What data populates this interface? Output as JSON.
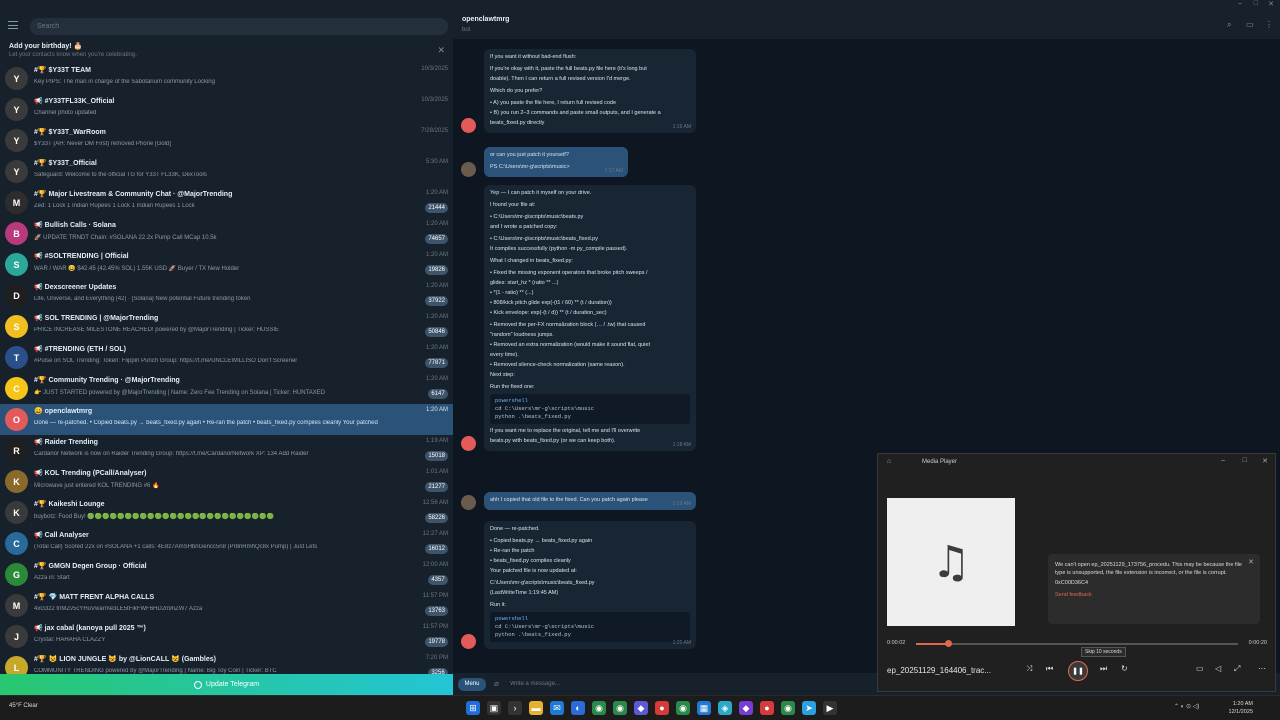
{
  "window": {
    "minimize": "–",
    "maximize": "□",
    "close": "✕"
  },
  "sidebar": {
    "search_placeholder": "Search",
    "birthday": {
      "title": "Add your birthday! 🎂",
      "subtitle": "Let your contacts know when you're celebrating."
    },
    "chats": [
      {
        "name": "#🏆 $Y33T TEAM",
        "time": "10/3/2025",
        "preview": "Key PIPS: The man in charge of the Sabotarium community Locking",
        "badge": "",
        "color": "#3a3a3a",
        "initial": "Y"
      },
      {
        "name": "📢 #Y33TFL33K_Official",
        "time": "10/3/2025",
        "preview": "Channel photo updated",
        "badge": "",
        "color": "#3a3a3a",
        "initial": "Y"
      },
      {
        "name": "#🏆 $Y33T_WarRoom",
        "time": "7/28/2025",
        "preview": "$Y33T (AH: Never DM First) removed Phone [Gold]",
        "badge": "",
        "color": "#3a3a3a",
        "initial": "Y"
      },
      {
        "name": "#🏆 $Y33T_Official",
        "time": "5:30 AM",
        "preview": "Safeguard: Welcome to the official TG for Y33T FL33K, DexTools",
        "badge": "",
        "color": "#3a3a3a",
        "initial": "Y"
      },
      {
        "name": "#🏆 Major Livestream & Community Chat · @MajorTrending",
        "time": "1:20 AM",
        "preview": "Zed: 1 Lock 1 Indian Rupees 1 Lock 1 Indian Rupees 1 Lock",
        "badge": "21444",
        "color": "#2d2d2d",
        "initial": "M"
      },
      {
        "name": "📢 Bullish Calls · Solana",
        "time": "1:20 AM",
        "preview": "🚀 UPDATE TRNDT Chain: #SOLANA 22.2x Pump Call MCap 10.5k",
        "badge": "74657",
        "color": "#b83a7a",
        "initial": "B"
      },
      {
        "name": "📢 #SOLTRENDING | Official",
        "time": "1:20 AM",
        "preview": "WAR / WAR 😀 $42.45 (42.45% SOL) 1.55K USD 🚀 Buyer / TX New Holder",
        "badge": "19826",
        "color": "#2aa89a",
        "initial": "S"
      },
      {
        "name": "📢 Dexscreener Updates",
        "time": "1:20 AM",
        "preview": "Life, Universe, and Everything (42) · [Solana] New potential Future trending token",
        "badge": "37922",
        "color": "#1f1f1f",
        "initial": "D"
      },
      {
        "name": "📢 SOL TRENDING | @MajorTrending",
        "time": "1:20 AM",
        "preview": "PRICE INCREASE MILESTONE REACHED! powered by @MajorTrending | Ticker: HUSSIE",
        "badge": "50846",
        "color": "#f0c020",
        "initial": "S"
      },
      {
        "name": "📢 #TRENDING (ETH / SOL)",
        "time": "1:20 AM",
        "preview": "#Pulse on SOL Trending: Token: Flippin Punch Group: https://t.me/UNCLEWILLISO Don't Screener",
        "badge": "77871",
        "color": "#2a4f8a",
        "initial": "T"
      },
      {
        "name": "#🏆 Community Trending · @MajorTrending",
        "time": "1:20 AM",
        "preview": "👉 JUST STARTED powered by @MajorTrending | Name: Zero Fee Trending on Solana | Ticker: HUNTAXED",
        "badge": "6147",
        "color": "#f5c518",
        "initial": "C"
      },
      {
        "name": "😀 openclawtmrg",
        "time": "1:20 AM",
        "preview": "Done — re-patched. • Copied beats.py → beats_fixed.py again • Re-ran the patch • beats_fixed.py compiles cleanly Your patched",
        "badge": "",
        "color": "#e35a5a",
        "initial": "O"
      },
      {
        "name": "📢 Raider Trending",
        "time": "1:19 AM",
        "preview": "Cardanor Network is now on Raider Trending Group: https://t.me/CardanorNetwork XP: 134 Add Raider",
        "badge": "15018",
        "color": "#1f1f1f",
        "initial": "R"
      },
      {
        "name": "📢 KOL Trending (PCall/Analyser)",
        "time": "1:01 AM",
        "preview": "Microwave just entered KOL TRENDING #6 🔥",
        "badge": "21277",
        "color": "#8a6a2a",
        "initial": "K"
      },
      {
        "name": "#🏆 Kaikeshi Lounge",
        "time": "12:56 AM",
        "preview": "buybotz: Food Buy! 🟢🟢🟢🟢🟢🟢🟢🟢🟢🟢🟢🟢🟢🟢🟢🟢🟢🟢🟢🟢🟢🟢🟢🟢🟢",
        "badge": "58226",
        "color": "#3a3a3a",
        "initial": "K"
      },
      {
        "name": "📢 Call Analyser",
        "time": "12:27 AM",
        "preview": "(Total Call) Scored 22x on #SOLANA +1 calls: 4E8z7AmSHbnGencc5n8 (Pr8nRmhQc8x Pump) | Just Lets",
        "badge": "16012",
        "color": "#2a6a9a",
        "initial": "C"
      },
      {
        "name": "#🏆 GMGN Degen Group · Official",
        "time": "12:00 AM",
        "preview": "Azza in: Start",
        "badge": "4357",
        "color": "#2a8a3a",
        "initial": "G"
      },
      {
        "name": "#🏆 💎 MATT FRENT ALPHA CALLS",
        "time": "11:57 PM",
        "preview": "4xG3z2 tnMZv5cYHuVwarme3LE5tFikFWF6HD2n9nZW7 Azza",
        "badge": "13763",
        "color": "#3a3a3a",
        "initial": "M"
      },
      {
        "name": "📢 jax cabal (kanoya pull 2025 ™)",
        "time": "11:57 PM",
        "preview": "Crystal: HAHAHA CLAZZY",
        "badge": "19778",
        "color": "#3a3a3a",
        "initial": "J"
      },
      {
        "name": "#🏆 😺 LION JUNGLE 😺 by @LionCALL 😺 (Gambles)",
        "time": "7:20 PM",
        "preview": "COMMUNITY TRENDING powered by @MajorTrending | Name: Big Toy Coin | Ticker: BTC",
        "badge": "3256",
        "color": "#c8a82a",
        "initial": "L"
      }
    ],
    "update_label": "Update Telegram"
  },
  "chat": {
    "title": "openclawtmrg",
    "status": "bot",
    "composer_placeholder": "Write a message...",
    "menu_label": "Menu",
    "messages": [
      {
        "lines": [
          "If you want it without bad-end flush:",
          "",
          "If you're okay with it, paste the full beats.py file here (it's long but",
          "doable). Then I can return a full revised version I'd merge.",
          "",
          "Which do you prefer?",
          "",
          "• A) you paste the file here, I return full revised code",
          "• B) you run 2–3 commands and paste small outputs, and I generate a",
          "beats_fixed.py directly"
        ],
        "time": "1:16 AM"
      },
      {
        "lines": [
          "or can you just patch it yourself?",
          "",
          "PS C:\\Users\\mr-g\\scripts\\music>"
        ],
        "time": "1:17 AM"
      },
      {
        "lines": [
          "Yep — I can patch it myself on your drive.",
          "",
          "I found your file at:",
          "",
          "• C:\\Users\\mr-g\\scripts\\music\\beats.py",
          "and I wrote a patched copy:",
          "",
          "• C:\\Users\\mr-g\\scripts\\music\\beats_fixed.py",
          "It compiles successfully (python -m py_compile passed).",
          "",
          "What I changed in beats_fixed.py:",
          "",
          "• Fixed the missing exponent operators that broke pitch sweeps /",
          "glides: start_hz * (ratio ** ...)",
          "• *(1 - ratio) ** (...)",
          "• 808/kick pitch glide exp(-(t1 / 60) ** (t / duration))",
          "• Kick envelope: exp(-(t / d)) ** (t / duration_sec)",
          "",
          "• Removed the per-FX normalization block (… / .tw) that caused",
          "\"random\" loudness jumps.",
          "• Removed an extra normalization (would make it sound flat, quiet",
          "every time).",
          "• Removed silence-check normalization (same reason).",
          "Next step:",
          "",
          "Run the fixed one:"
        ],
        "code": [
          "powershell",
          "cd C:\\Users\\mr-g\\scripts\\music",
          "python .\\beats_fixed.py"
        ],
        "after": [
          "If you want me to replace the original, tell me and I'll overwrite",
          "beats.py with beats_fixed.py (or we can keep both)."
        ],
        "time": "1:18 AM"
      },
      {
        "lines": [
          "ahh I copied that old file to the fixed. Can you patch again please"
        ],
        "time": "1:19 AM"
      },
      {
        "lines": [
          "Done — re-patched.",
          "",
          "• Copied beats.py → beats_fixed.py again",
          "• Re-ran the patch",
          "• beats_fixed.py compiles cleanly",
          "Your patched file is now updated at:",
          "",
          "C:\\Users\\mr-g\\scripts\\music\\beats_fixed.py",
          "(LastWriteTime 1:19:45 AM)",
          "",
          "Run it:"
        ],
        "code": [
          "powershell",
          "cd C:\\Users\\mr-g\\scripts\\music",
          "python .\\beats_fixed.py"
        ],
        "time": "1:20 AM"
      }
    ]
  },
  "media_player": {
    "title": "Media Player",
    "error_text": "We can't open ep_20251129_173756_procedu. This may be because the file type is unsupported, the file extension is incorrect, or the file is corrupt.",
    "error_code": "0xC00D36C4",
    "feedback_link": "Send feedback",
    "elapsed": "0:00:02",
    "duration": "0:00:20",
    "progress": 0.1,
    "track_name": "ep_20251129_164406_trac...",
    "tooltip": "Skip 10 seconds"
  },
  "taskbar": {
    "weather_temp": "45°F",
    "weather_desc": "Clear",
    "clock_time": "1:20 AM",
    "clock_date": "12/1/2025"
  },
  "colors": {
    "accent": "#2b5278",
    "link": "#6ab3f3",
    "player_accent": "#e0694b"
  }
}
